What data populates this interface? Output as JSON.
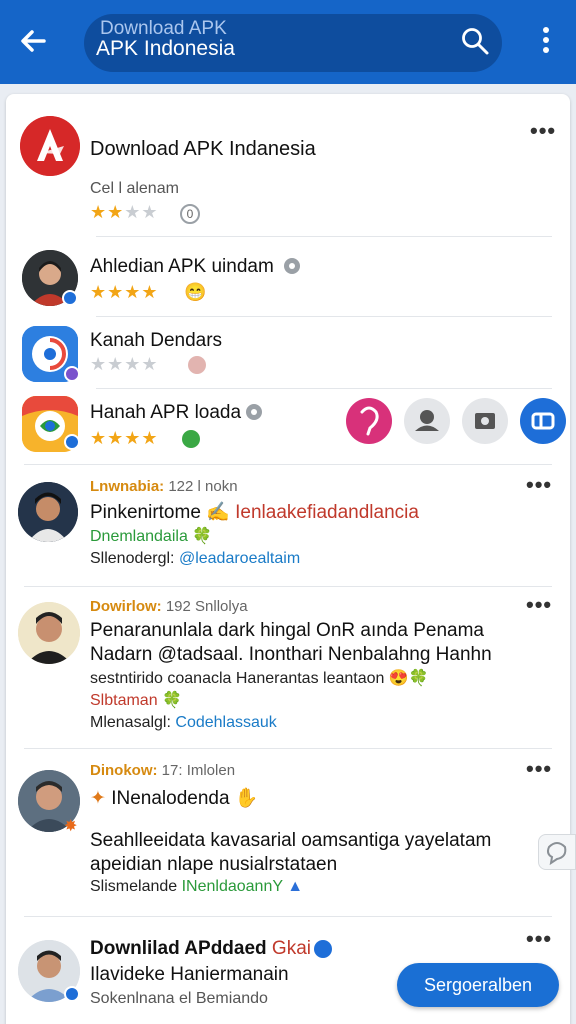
{
  "search": {
    "placeholder": "Download APK",
    "query": "APK Indonesia"
  },
  "apps": [
    {
      "name": "Download APK Indanesia",
      "subtitle": "Cel l alenam",
      "rating_text": "★★",
      "rating_off": "★★",
      "badge": "0"
    },
    {
      "name": "Ahledian APK uindam",
      "rating_text": "★★★★",
      "rating_off": ""
    },
    {
      "name": "Kanah Dendars",
      "rating_text": "",
      "rating_off": "★★★★"
    },
    {
      "name": "Hanah APR loada",
      "rating_text": "★★★★",
      "rating_off": ""
    }
  ],
  "posts": [
    {
      "meta_name": "Lnwnabia:",
      "meta_info": "122 l nokn",
      "line1_a": "Pinkenirtome",
      "line1_b": "Ienlaakefiadandlancia",
      "line2": "Dnemlandaila",
      "line3_a": "Sllenodergl:",
      "line3_b": "@leadaroealtaim"
    },
    {
      "meta_name": "Dowirlow:",
      "meta_info": "192 Snllolya",
      "line1": "Penaranunlala dark hingal OnR aında Penama",
      "line2": "Nadarn @tadsaal. Inonthari Nenbalahng Hanhn",
      "line3": "sestntirido coanacla Hanerantas leantaon",
      "line4": "Slbtaman",
      "line5_a": "Mlenasalgl:",
      "line5_b": "Codehlassauk"
    },
    {
      "meta_name": "Dinokow:",
      "meta_info": "17: Imlolen",
      "line1": "INenalodenda",
      "line2": "Seahlleeidata kavasarial oamsantiga yayelatam",
      "line3": "apeidian nlape nusialrstataen",
      "line4_a": "Slismelande",
      "line4_b": "INenldaoannY"
    },
    {
      "title": "Downlilad APddaed",
      "title_tag": "Gkai",
      "line1": "Ilavideke Haniermanain",
      "line2": "Sokenlnana el Bemiando"
    }
  ],
  "more_label": "•••",
  "fab_label": "Sergoeralben",
  "colors": {
    "appbar": "#1565c8",
    "accent": "#1a6fd4",
    "star": "#f2a516"
  }
}
